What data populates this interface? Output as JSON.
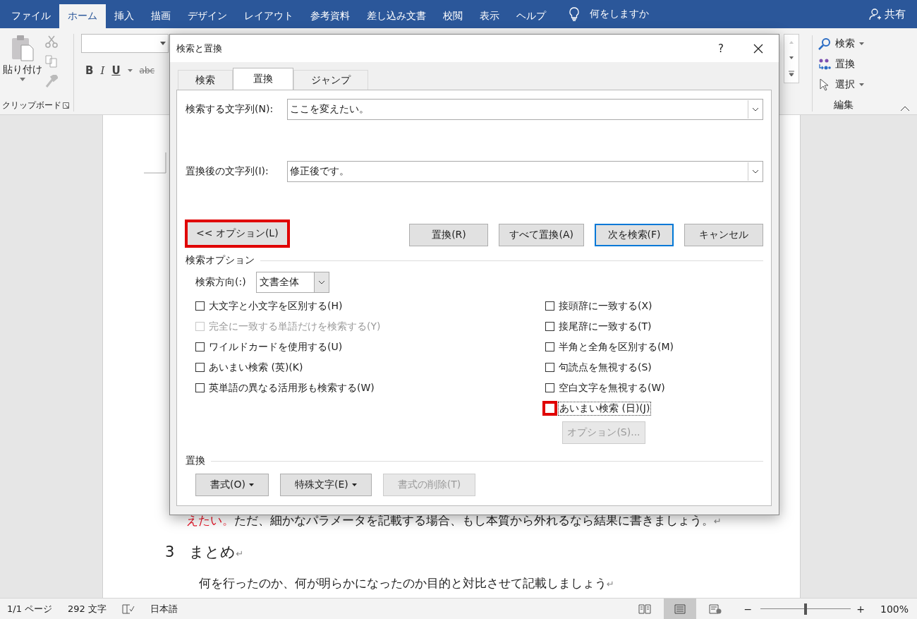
{
  "menu_tabs": [
    {
      "label": "ファイル",
      "selected": false
    },
    {
      "label": "ホーム",
      "selected": true
    },
    {
      "label": "挿入",
      "selected": false
    },
    {
      "label": "描画",
      "selected": false
    },
    {
      "label": "デザイン",
      "selected": false
    },
    {
      "label": "レイアウト",
      "selected": false
    },
    {
      "label": "参考資料",
      "selected": false
    },
    {
      "label": "差し込み文書",
      "selected": false
    },
    {
      "label": "校閲",
      "selected": false
    },
    {
      "label": "表示",
      "selected": false
    },
    {
      "label": "ヘルプ",
      "selected": false
    }
  ],
  "tell_me": "何をしますか",
  "share": "共有",
  "clipboard": {
    "paste": "貼り付け",
    "group": "クリップボード"
  },
  "font": {
    "bold": "B",
    "italic": "I",
    "underline": "U",
    "strike": "abc"
  },
  "editing": {
    "items": [
      {
        "kind": "search",
        "label": "検索",
        "menu": true
      },
      {
        "kind": "replace",
        "label": "置換",
        "menu": false
      },
      {
        "kind": "select",
        "label": "選択",
        "menu": true
      }
    ],
    "group": "編集"
  },
  "document": {
    "lines": [
      {
        "kind": "body",
        "parts": [
          {
            "text": "えたい。",
            "red": true
          },
          {
            "text": "ただ、細かなパラメータを記載する場合、もし本質から外れるなら結果に書きましょう。",
            "red": false
          }
        ],
        "mark": "↵"
      },
      {
        "kind": "heading",
        "parts": [
          {
            "text": "3　まとめ",
            "red": false
          }
        ],
        "mark": "↵"
      },
      {
        "kind": "indent",
        "parts": [
          {
            "text": "何を行ったのか、何が明らかになったのか目的と対比させて記載しましょう",
            "red": false
          }
        ],
        "mark": "↵"
      }
    ]
  },
  "dialog": {
    "title": "検索と置換",
    "help": "?",
    "tabs": [
      {
        "label": "検索",
        "selected": false
      },
      {
        "label": "置換",
        "selected": true
      },
      {
        "label": "ジャンプ",
        "selected": false
      }
    ],
    "fields": [
      {
        "label": "検索する文字列(N):",
        "value": "ここを変えたい。"
      },
      {
        "label": "置換後の文字列(I):",
        "value": "修正後です。"
      }
    ],
    "less_button": {
      "label": "<< オプション(L)",
      "highlighted": true
    },
    "buttons": [
      {
        "label": "置換(R)",
        "default": false
      },
      {
        "label": "すべて置換(A)",
        "default": false
      },
      {
        "label": "次を検索(F)",
        "default": true
      },
      {
        "label": "キャンセル",
        "default": false
      }
    ],
    "options_title": "検索オプション",
    "direction_label": "検索方向(:)",
    "direction_value": "文書全体",
    "left_checks": [
      {
        "label": "大文字と小文字を区別する(H)",
        "checked": false,
        "disabled": false
      },
      {
        "label": "完全に一致する単語だけを検索する(Y)",
        "checked": false,
        "disabled": true
      },
      {
        "label": "ワイルドカードを使用する(U)",
        "checked": false,
        "disabled": false
      },
      {
        "label": "あいまい検索 (英)(K)",
        "checked": false,
        "disabled": false
      },
      {
        "label": "英単語の異なる活用形も検索する(W)",
        "checked": false,
        "disabled": false
      }
    ],
    "right_checks": [
      {
        "label": "接頭辞に一致する(X)",
        "checked": false,
        "highlighted": false,
        "focused": false
      },
      {
        "label": "接尾辞に一致する(T)",
        "checked": false,
        "highlighted": false,
        "focused": false
      },
      {
        "label": "半角と全角を区別する(M)",
        "checked": false,
        "highlighted": false,
        "focused": false
      },
      {
        "label": "句読点を無視する(S)",
        "checked": false,
        "highlighted": false,
        "focused": false
      },
      {
        "label": "空白文字を無視する(W)",
        "checked": false,
        "highlighted": false,
        "focused": false
      },
      {
        "label": "あいまい検索 (日)(J)",
        "checked": false,
        "highlighted": true,
        "focused": true
      }
    ],
    "fuzzy_options": {
      "label": "オプション(S)...",
      "disabled": true
    },
    "replace_title": "置換",
    "replace_buttons": [
      {
        "label": "書式(O)",
        "menu": true,
        "disabled": false
      },
      {
        "label": "特殊文字(E)",
        "menu": true,
        "disabled": false
      },
      {
        "label": "書式の削除(T)",
        "menu": false,
        "disabled": true
      }
    ]
  },
  "status_bar": {
    "page": "1/1 ページ",
    "words": "292 文字",
    "language": "日本語",
    "views": [
      {
        "kind": "read",
        "selected": false
      },
      {
        "kind": "print",
        "selected": true
      },
      {
        "kind": "web",
        "selected": false
      }
    ],
    "zoom_out": "−",
    "zoom_in": "+",
    "zoom": {
      "level": 0.5
    },
    "zoom_text": "100%"
  }
}
